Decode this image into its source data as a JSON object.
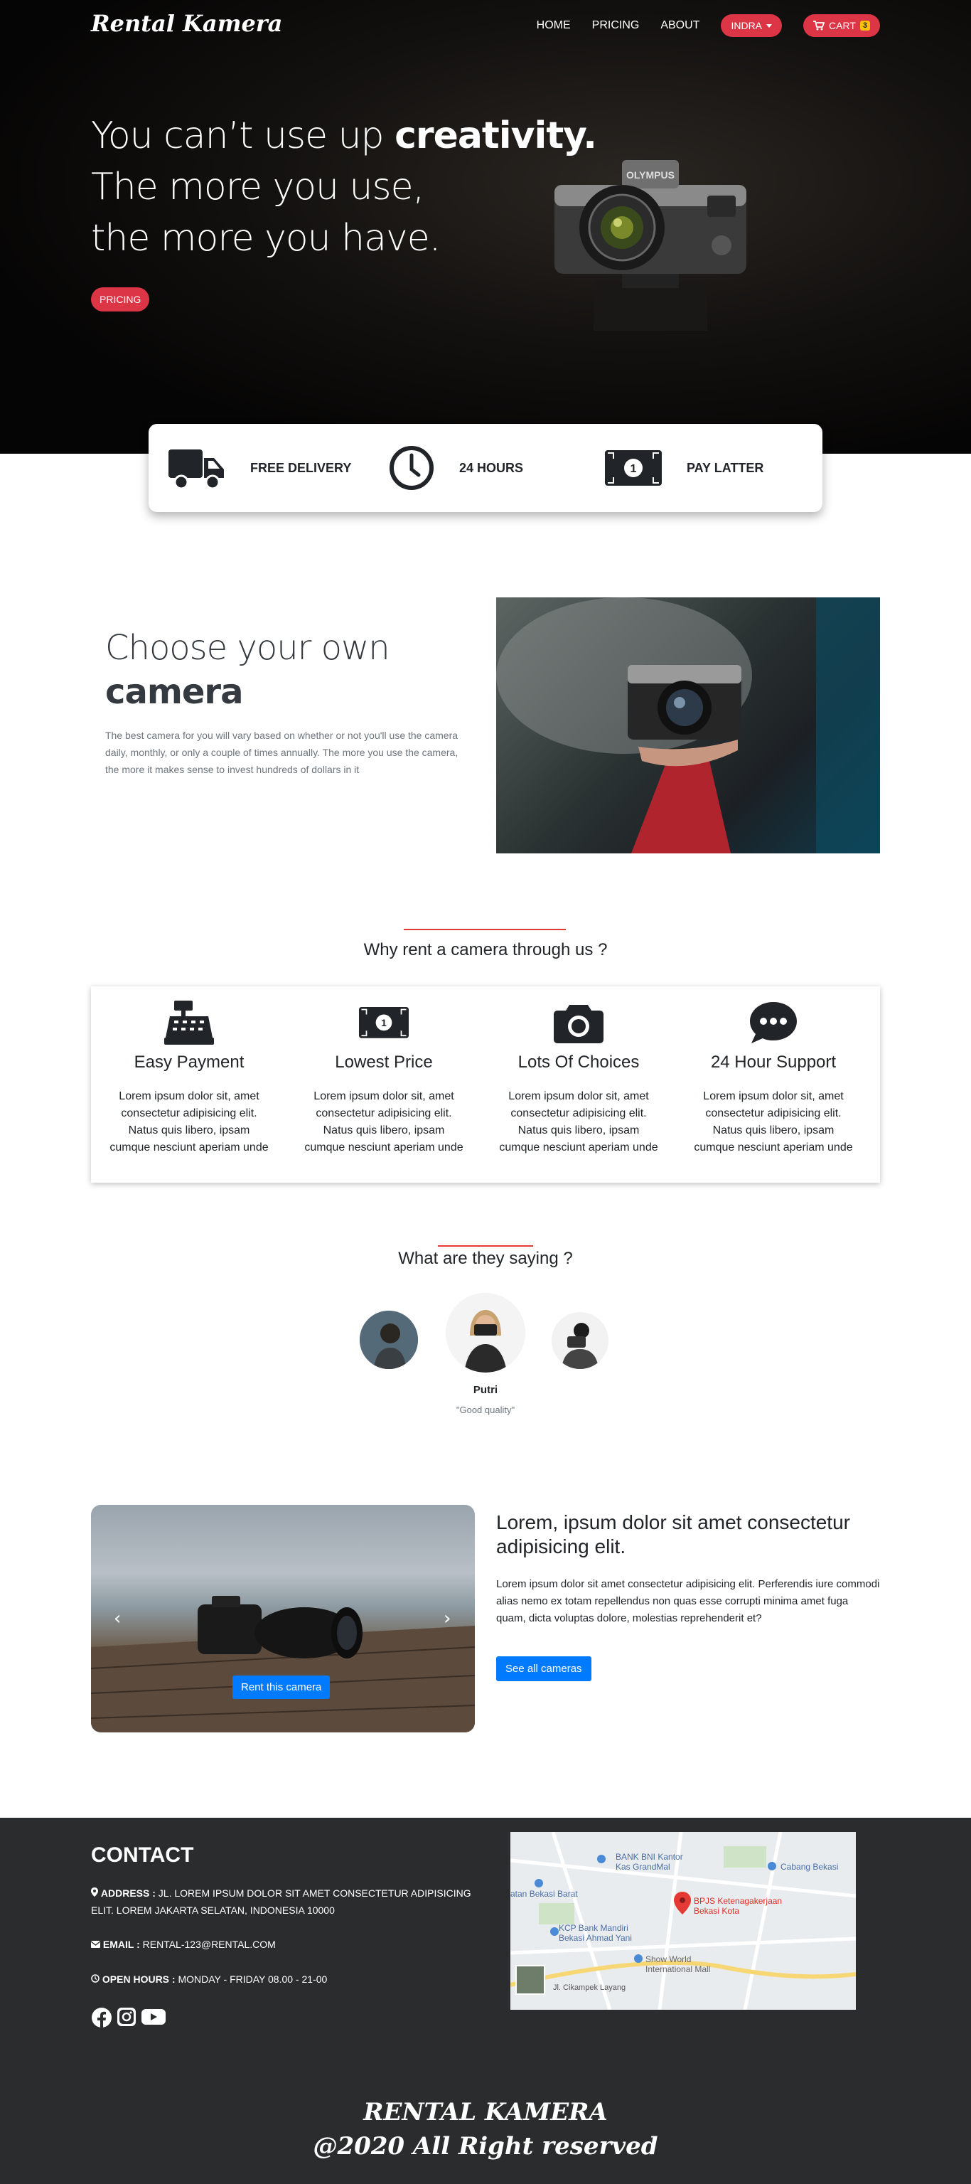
{
  "nav": {
    "brand": "Rental Kamera",
    "links": [
      "HOME",
      "PRICING",
      "ABOUT"
    ],
    "user_label": "INDRA",
    "cart_label": "CART",
    "cart_count": "3"
  },
  "hero": {
    "line1_prefix": "You can’t use up ",
    "line1_bold": "creativity.",
    "line2": "The more you use,",
    "line3": "the more you have.",
    "button": "PRICING"
  },
  "features": [
    {
      "icon": "truck-icon",
      "label": "FREE DELIVERY"
    },
    {
      "icon": "clock-icon",
      "label": "24 HOURS"
    },
    {
      "icon": "money-bill-icon",
      "label": "PAY LATTER"
    }
  ],
  "choose": {
    "title_light": "Choose your own",
    "title_bold": "camera",
    "text": "The best camera for you will vary based on whether or not you'll use the camera daily, monthly, or only a couple of times annually. The more you use the camera, the more it makes sense to invest hundreds of dollars in it"
  },
  "why": {
    "heading": "Why rent a camera through us ?",
    "items": [
      {
        "icon": "cash-register-icon",
        "title": "Easy Payment",
        "text": "Lorem ipsum dolor sit, amet consectetur adipisicing elit. Natus quis libero, ipsam cumque nesciunt aperiam unde"
      },
      {
        "icon": "money-bill-icon",
        "title": "Lowest Price",
        "text": "Lorem ipsum dolor sit, amet consectetur adipisicing elit. Natus quis libero, ipsam cumque nesciunt aperiam unde"
      },
      {
        "icon": "camera-icon",
        "title": "Lots Of Choices",
        "text": "Lorem ipsum dolor sit, amet consectetur adipisicing elit. Natus quis libero, ipsam cumque nesciunt aperiam unde"
      },
      {
        "icon": "comment-dots-icon",
        "title": "24 Hour Support",
        "text": "Lorem ipsum dolor sit, amet consectetur adipisicing elit. Natus quis libero, ipsam cumque nesciunt aperiam unde"
      }
    ]
  },
  "testimonials": {
    "heading": "What are they saying ?",
    "active_name": "Putri",
    "active_quote": "\"Good quality\""
  },
  "promo": {
    "title": "Lorem, ipsum dolor sit amet consectetur adipisicing elit.",
    "text": "Lorem ipsum dolor sit amet consectetur adipisicing elit. Perferendis iure commodi alias nemo ex totam repellendus non quas esse corrupti minima amet fuga quam, dicta voluptas dolore, molestias reprehenderit et?",
    "carousel_button": "Rent this camera",
    "button": "See all cameras"
  },
  "footer": {
    "contact_heading": "CONTACT",
    "address_label": "ADDRESS :",
    "address": "JL. LOREM IPSUM DOLOR SIT AMET CONSECTETUR ADIPISICING ELIT. LOREM JAKARTA SELATAN, INDONESIA 10000",
    "email_label": "EMAIL :",
    "email": "RENTAL-123@RENTAL.COM",
    "hours_label": "OPEN HOURS :",
    "hours": "MONDAY - FRIDAY 08.00 - 21-00",
    "brand": "RENTAL KAMERA",
    "copyright": "@2020 All Right reserved",
    "map_labels": {
      "bni": "BANK BNI Kantor Kas GrandMal",
      "bekasi": "Cabang Bekasi",
      "bekasi_barat": "atan Bekasi Barat",
      "bpjs": "BPJS Ketenagakerjaan Bekasi Kota",
      "mandiri": "KCP Bank Mandiri Bekasi Ahmad Yani",
      "showworld": "Show World International Mall",
      "road": "Jl. Cikampek Layang"
    }
  }
}
